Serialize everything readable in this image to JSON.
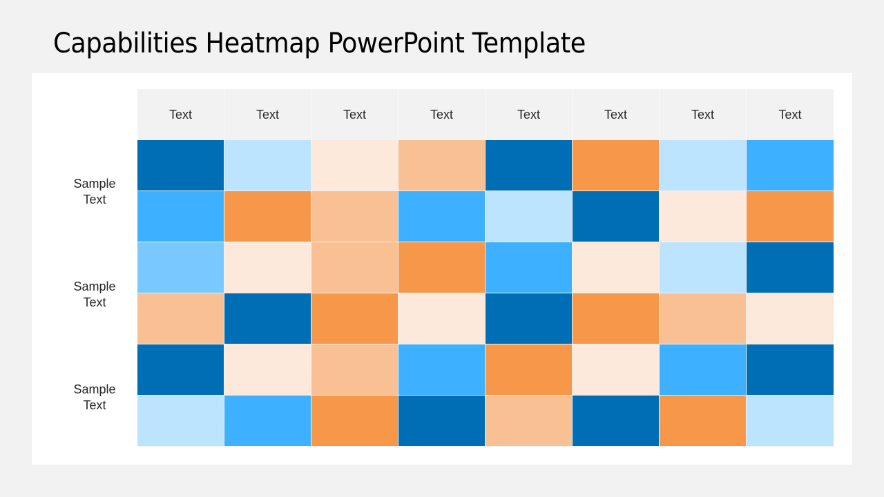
{
  "slide": {
    "title": "Capabilities Heatmap PowerPoint Template"
  },
  "row_groups": [
    {
      "label_line1": "Sample",
      "label_line2": "Text"
    },
    {
      "label_line1": "Sample",
      "label_line2": "Text"
    },
    {
      "label_line1": "Sample",
      "label_line2": "Text"
    }
  ],
  "chart_data": {
    "type": "heatmap",
    "title": "Capabilities Heatmap PowerPoint Template",
    "columns": [
      "Text",
      "Text",
      "Text",
      "Text",
      "Text",
      "Text",
      "Text",
      "Text"
    ],
    "row_group_labels": [
      "Sample Text",
      "Sample Text",
      "Sample Text"
    ],
    "rows_per_group": 2,
    "color_scale": {
      "A": "#006EB5",
      "B": "#3DB1FF",
      "C": "#79C9FF",
      "D": "#BDE4FF",
      "E": "#FCE9DB",
      "F": "#F9C093",
      "G": "#F6974A"
    },
    "cells": [
      [
        "A",
        "D",
        "E",
        "F",
        "A",
        "G",
        "D",
        "B"
      ],
      [
        "B",
        "G",
        "F",
        "B",
        "D",
        "A",
        "E",
        "G"
      ],
      [
        "C",
        "E",
        "F",
        "G",
        "B",
        "E",
        "D",
        "A"
      ],
      [
        "F",
        "A",
        "G",
        "E",
        "A",
        "G",
        "F",
        "E"
      ],
      [
        "A",
        "E",
        "F",
        "B",
        "G",
        "E",
        "B",
        "A"
      ],
      [
        "D",
        "B",
        "G",
        "A",
        "F",
        "A",
        "G",
        "D"
      ]
    ]
  }
}
